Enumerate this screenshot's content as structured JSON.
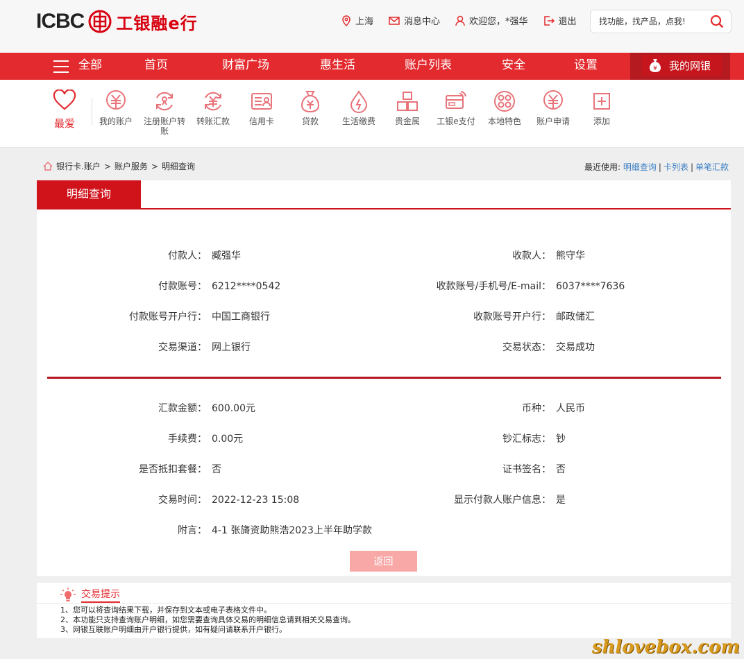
{
  "brand": {
    "logo_text": "ICBC",
    "logo_cn": "工银融e行",
    "accent": "#e32a2e"
  },
  "top_links": [
    {
      "label": "上海",
      "icon": "location-pin-icon"
    },
    {
      "label": "消息中心",
      "icon": "mail-icon"
    },
    {
      "label": "欢迎您，*强华",
      "icon": "user-icon"
    },
    {
      "label": "退出",
      "icon": "logout-icon"
    }
  ],
  "search": {
    "placeholder": "找功能，找产品，点我!"
  },
  "nav": {
    "all": "全部",
    "items": [
      "首页",
      "财富广场",
      "惠生活",
      "账户列表",
      "安全",
      "设置"
    ],
    "mybank": "我的网银"
  },
  "favorites": {
    "label": "最爱"
  },
  "shortcuts": [
    {
      "label": "我的账户",
      "icon": "yuan-bubble-icon"
    },
    {
      "label": "注册账户转账",
      "icon": "register-transfer-icon"
    },
    {
      "label": "转账汇款",
      "icon": "transfer-icon"
    },
    {
      "label": "信用卡",
      "icon": "credit-card-icon"
    },
    {
      "label": "贷款",
      "icon": "money-bag-icon"
    },
    {
      "label": "生活缴费",
      "icon": "drop-icon"
    },
    {
      "label": "贵金属",
      "icon": "gold-bars-icon"
    },
    {
      "label": "工银e支付",
      "icon": "epay-card-icon"
    },
    {
      "label": "本地特色",
      "icon": "local-icon"
    },
    {
      "label": "账户申请",
      "icon": "account-apply-icon"
    },
    {
      "label": "添加",
      "icon": "add-icon"
    }
  ],
  "breadcrumb": [
    "银行卡.账户",
    "账户服务",
    "明细查询"
  ],
  "recent": {
    "label": "最近使用:",
    "links": [
      "明细查询",
      "卡列表",
      "单笔汇款"
    ]
  },
  "panel": {
    "title": "明细查询"
  },
  "details": {
    "payer_label": "付款人：",
    "payer": "臧强华",
    "payee_label": "收款人：",
    "payee": "熊守华",
    "payer_acct_label": "付款账号：",
    "payer_acct": "6212****0542",
    "payee_acct_label": "收款账号/手机号/E-mail：",
    "payee_acct": "6037****7636",
    "payer_bank_label": "付款账号开户行：",
    "payer_bank": "中国工商银行",
    "payee_bank_label": "收款账号开户行：",
    "payee_bank": "邮政储汇",
    "channel_label": "交易渠道：",
    "channel": "网上银行",
    "status_label": "交易状态：",
    "status": "交易成功",
    "amount_label": "汇款金额：",
    "amount": "600.00元",
    "currency_label": "币种：",
    "currency": "人民币",
    "fee_label": "手续费：",
    "fee": "0.00元",
    "cash_label": "钞汇标志：",
    "cash": "钞",
    "package_label": "是否抵扣套餐：",
    "package": "否",
    "cert_label": "证书签名：",
    "cert": "否",
    "time_label": "交易时间：",
    "time": "2022-12-23 15:08",
    "show_payer_label": "显示付款人账户信息：",
    "show_payer": "是",
    "memo_label": "附言：",
    "memo": "4-1 张旖资助熊浩2023上半年助学款"
  },
  "back_button": "返回",
  "tips": {
    "title": "交易提示",
    "items": [
      "1、您可以将查询结果下载，并保存到文本或电子表格文件中。",
      "2、本功能只支持查询账户明细，如您需要查询具体交易的明细信息请到相关交易查询。",
      "3、网银互联账户明细由开户银行提供，如有疑问请联系开户银行。"
    ]
  },
  "watermark": "shlovebox.com"
}
